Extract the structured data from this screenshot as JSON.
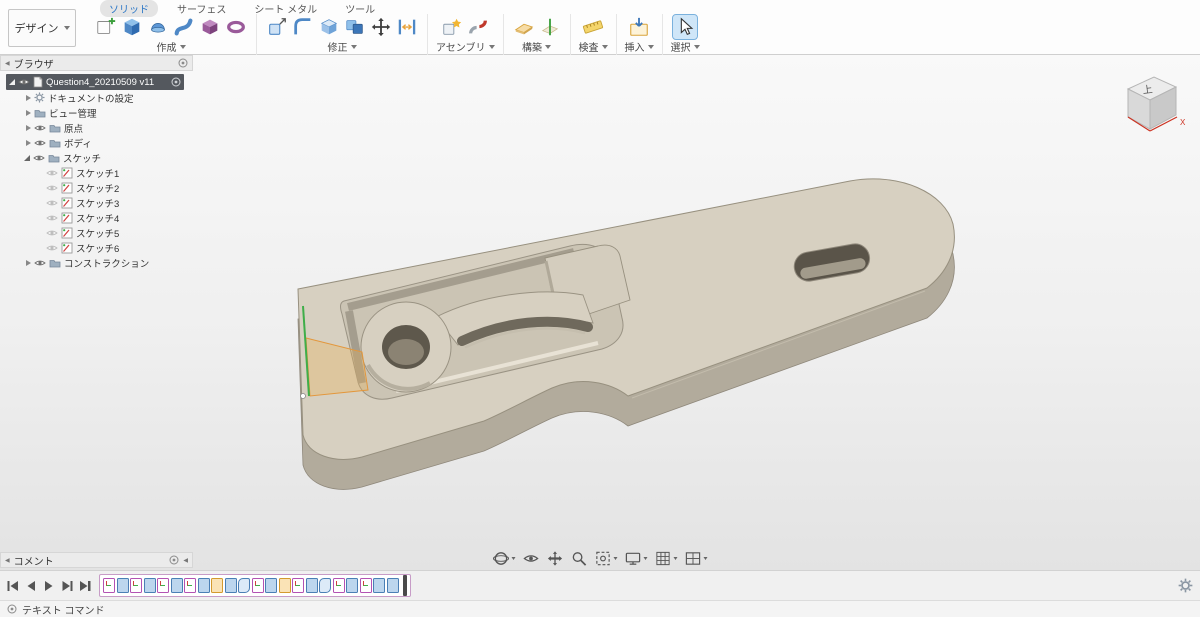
{
  "header": {
    "design_button": {
      "label": "デザイン"
    },
    "tabs": [
      {
        "label": "ソリッド",
        "active": true
      },
      {
        "label": "サーフェス",
        "active": false
      },
      {
        "label": "シート メタル",
        "active": false
      },
      {
        "label": "ツール",
        "active": false
      }
    ],
    "groups": [
      {
        "label": "作成"
      },
      {
        "label": "修正"
      },
      {
        "label": "アセンブリ"
      },
      {
        "label": "構築"
      },
      {
        "label": "検査"
      },
      {
        "label": "挿入"
      },
      {
        "label": "選択"
      }
    ]
  },
  "browser": {
    "title": "ブラウザ",
    "root_item": {
      "label": "Question4_20210509 v11",
      "selected": true
    },
    "items": [
      {
        "label": "ドキュメントの設定",
        "icon": "gear"
      },
      {
        "label": "ビュー管理",
        "icon": "folder"
      },
      {
        "label": "原点",
        "icon": "folder"
      },
      {
        "label": "ボディ",
        "icon": "folder"
      },
      {
        "label": "スケッチ",
        "icon": "folder",
        "expanded": true
      },
      {
        "label": "コンストラクション",
        "icon": "folder"
      }
    ],
    "sketch_items": [
      {
        "label": "スケッチ1"
      },
      {
        "label": "スケッチ2"
      },
      {
        "label": "スケッチ3"
      },
      {
        "label": "スケッチ4"
      },
      {
        "label": "スケッチ5"
      },
      {
        "label": "スケッチ6"
      }
    ]
  },
  "viewcube": {
    "top_face_label": "上",
    "axis_label": "X"
  },
  "navbar": {
    "icons": [
      "orbit",
      "look-at",
      "pan",
      "zoom",
      "fit-to-view",
      "display-settings",
      "grid-settings",
      "viewports"
    ]
  },
  "comments_panel": {
    "title": "コメント"
  },
  "timeline": {
    "playback": [
      "go-to-start",
      "step-back",
      "play",
      "step-forward",
      "go-to-end"
    ],
    "features": [
      "sketch",
      "extrude",
      "sketch",
      "extrude",
      "sketch",
      "extrude",
      "sketch",
      "extrude",
      "construct",
      "extrude",
      "fillet",
      "sketch",
      "extrude",
      "construct",
      "sketch",
      "extrude",
      "fillet",
      "sketch",
      "extrude",
      "sketch",
      "extrude",
      "extrude"
    ]
  },
  "status_bar": {
    "label": "テキスト コマンド"
  },
  "model": {
    "part_color": "#d7d0c1",
    "pocket_color": "#cbc4b4",
    "sketch_line_green": "#3fae49",
    "sketch_line_orange": "#e8a33d"
  }
}
